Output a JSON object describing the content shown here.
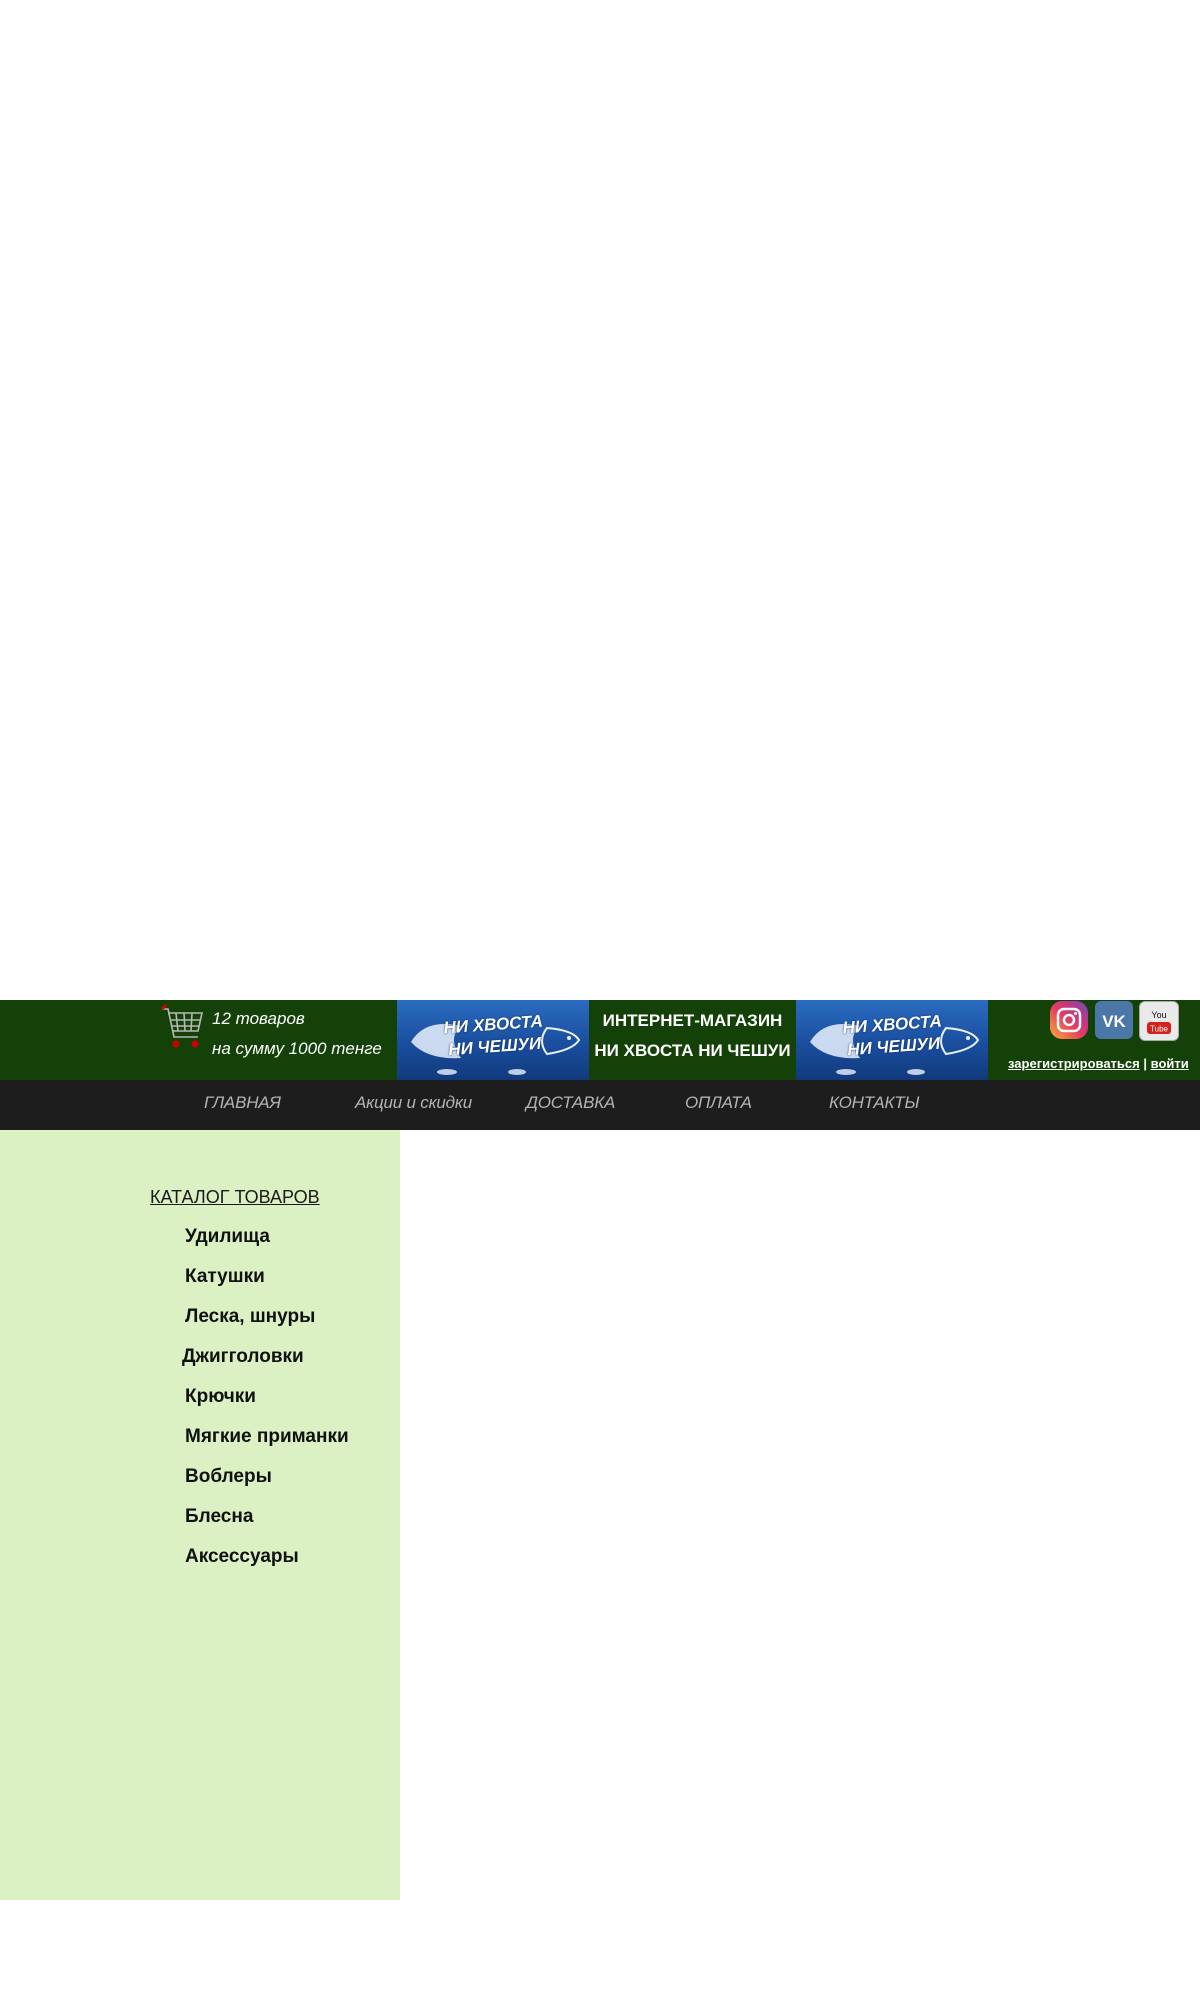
{
  "header": {
    "cart": {
      "icon": "shopping-cart-icon",
      "items_text": "12 товаров",
      "sum_text": "на сумму 1000 тенге"
    },
    "banner_text": "НИ ХВОСТА НИ ЧЕШУИ",
    "shop_title_line1": "ИНТЕРНЕТ-МАГАЗИН",
    "shop_title_line2": "НИ ХВОСТА НИ ЧЕШУИ",
    "social": [
      "instagram-icon",
      "vk-icon",
      "youtube-icon"
    ],
    "youtube_label": "You Tube",
    "vk_label": "VK",
    "auth": {
      "register": "зарегистрироваться",
      "separator": "|",
      "login": "войти"
    }
  },
  "nav": [
    "ГЛАВНАЯ",
    "Акции и скидки",
    "ДОСТАВКА",
    "ОПЛАТА",
    "КОНТАКТЫ"
  ],
  "catalog": {
    "title": "КАТАЛОГ ТОВАРОВ",
    "items": [
      "Удилища",
      "Катушки",
      "Леска, шнуры",
      "Джигголовки",
      "Крючки",
      "Мягкие приманки",
      "Воблеры",
      "Блесна",
      "Аксессуары"
    ]
  },
  "colors": {
    "header_bg": "#134107",
    "nav_bg": "#1d1d1d",
    "sidebar_bg": "#dbf1c4",
    "banner_blue": "#1a4e9e"
  }
}
